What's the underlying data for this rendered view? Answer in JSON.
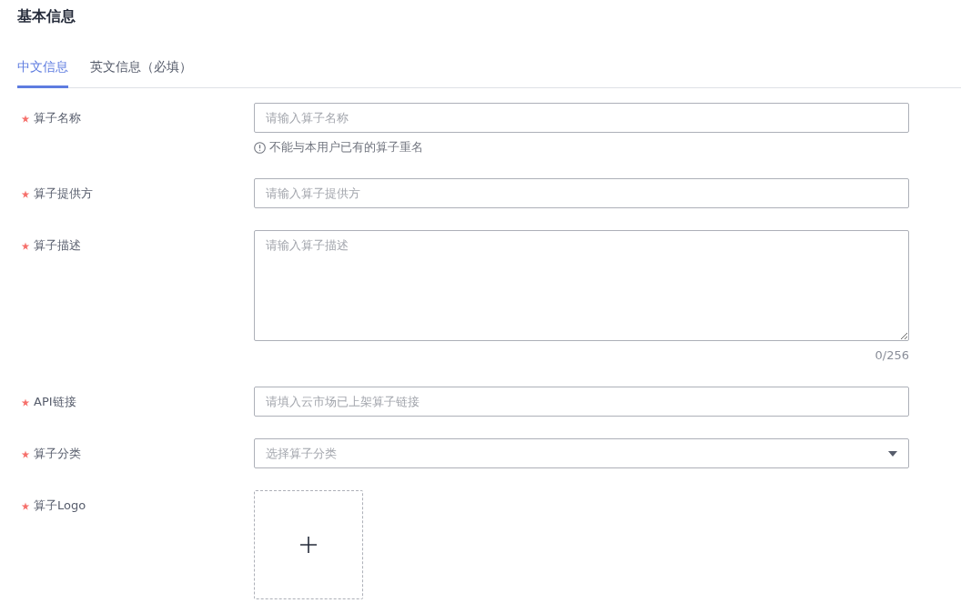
{
  "title": "基本信息",
  "tabs": [
    {
      "label": "中文信息",
      "selected": true
    },
    {
      "label": "英文信息（必填）",
      "selected": false
    }
  ],
  "fields": [
    {
      "kind": "text",
      "label": "算子名称",
      "required": true,
      "placeholder": "请输入算子名称",
      "hint": "不能与本用户已有的算子重名"
    },
    {
      "kind": "text",
      "label": "算子提供方",
      "required": true,
      "placeholder": "请输入算子提供方"
    },
    {
      "kind": "textarea",
      "label": "算子描述",
      "required": true,
      "placeholder": "请输入算子描述",
      "counter": "0/256"
    },
    {
      "kind": "text",
      "label": "API链接",
      "required": true,
      "placeholder": "请填入云市场已上架算子链接"
    },
    {
      "kind": "select",
      "label": "算子分类",
      "required": true,
      "placeholder": "选择算子分类"
    },
    {
      "kind": "upload",
      "label": "算子Logo",
      "required": true
    }
  ]
}
